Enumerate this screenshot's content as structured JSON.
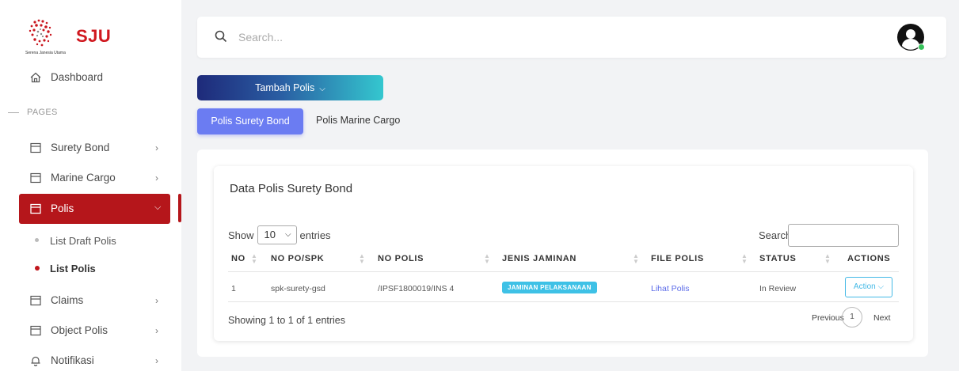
{
  "brand": {
    "name": "SJU",
    "subtitle": "Serena Janesia Utama",
    "color": "#d0181f"
  },
  "sidebar": {
    "dashboard": "Dashboard",
    "pages_label": "PAGES",
    "items": [
      {
        "label": "Surety Bond",
        "icon": "calendar-icon"
      },
      {
        "label": "Marine Cargo",
        "icon": "calendar-icon"
      },
      {
        "label": "Polis",
        "icon": "calendar-icon",
        "active": true
      },
      {
        "label": "Claims",
        "icon": "calendar-icon"
      },
      {
        "label": "Object Polis",
        "icon": "calendar-icon"
      },
      {
        "label": "Notifikasi",
        "icon": "bell-icon"
      }
    ],
    "sub_items": [
      {
        "label": "List Draft Polis"
      },
      {
        "label": "List Polis",
        "active": true
      }
    ],
    "active_color": "#b5161b"
  },
  "topbar": {
    "search_placeholder": "Search..."
  },
  "actions": {
    "tambah_label": "Tambah Polis"
  },
  "tabs": [
    {
      "label": "Polis Surety Bond",
      "active": true
    },
    {
      "label": "Polis Marine Cargo"
    }
  ],
  "table": {
    "title": "Data Polis Surety Bond",
    "show_label": "Show",
    "entries_value": "10",
    "entries_label": "entries",
    "search_label": "Search:",
    "columns": [
      "NO",
      "NO PO/SPK",
      "NO POLIS",
      "JENIS JAMINAN",
      "FILE POLIS",
      "STATUS",
      "ACTIONS"
    ],
    "rows": [
      {
        "no": "1",
        "spk": "spk-surety-gsd",
        "polis": "/IPSF1800019/INS 4",
        "jaminan": "JAMINAN PELAKSANAAN",
        "file": "Lihat Polis",
        "status": "In Review",
        "action": "Action"
      }
    ],
    "info": "Showing 1 to 1 of 1 entries",
    "pagination": {
      "prev": "Previous",
      "page": "1",
      "next": "Next"
    }
  }
}
